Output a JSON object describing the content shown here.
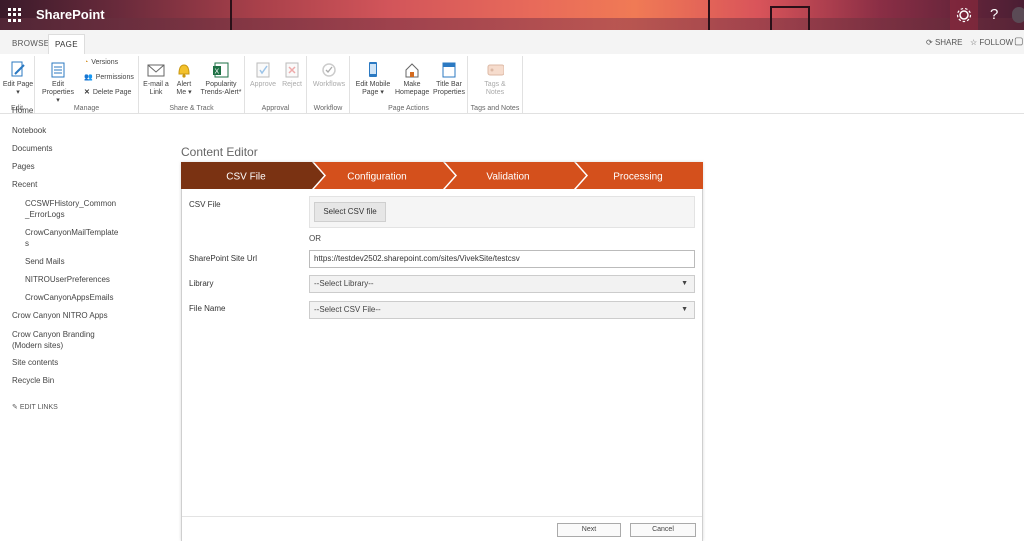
{
  "suite": {
    "brand": "SharePoint",
    "help_glyph": "?"
  },
  "ribbon_tabs": [
    "BROWSE",
    "PAGE"
  ],
  "actions": {
    "share": "SHARE",
    "follow": "FOLLOW"
  },
  "groups": {
    "edit": {
      "label": "Edit",
      "edit_page": "Edit Page"
    },
    "manage": {
      "label": "Manage",
      "edit_properties": "Edit Properties",
      "versions": "Versions",
      "permissions": "Permissions",
      "delete_page": "Delete Page"
    },
    "share_track": {
      "label": "Share & Track",
      "email_link": "E-mail a Link",
      "alert_me": "Alert Me",
      "popularity": "Popularity Trends-Alert*"
    },
    "approval": {
      "label": "Approval",
      "approve": "Approve",
      "reject": "Reject"
    },
    "workflow": {
      "label": "Workflow",
      "workflows": "Workflows"
    },
    "page_actions": {
      "label": "Page Actions",
      "edit_mobile": "Edit Mobile Page",
      "make_homepage": "Make Homepage",
      "title_bar": "Title Bar Properties"
    },
    "tags_notes": {
      "label": "Tags and Notes",
      "tags": "Tags & Notes"
    }
  },
  "left_nav": {
    "items": [
      "Home",
      "Notebook",
      "Documents",
      "Pages",
      "Recent",
      "CCSWFHistory_Common_ErrorLogs",
      "CrowCanyonMailTemplates",
      "Send Mails",
      "NITROUserPreferences",
      "CrowCanyonAppsEmails",
      "Crow Canyon NITRO Apps",
      "Crow Canyon Branding (Modern sites)",
      "Site contents",
      "Recycle Bin"
    ],
    "edit_links": "EDIT LINKS"
  },
  "content_editor": {
    "title": "Content Editor",
    "steps": [
      "CSV File",
      "Configuration",
      "Validation",
      "Processing"
    ],
    "csv_file_label": "CSV File",
    "select_csv_button": "Select CSV file",
    "or_text": "OR",
    "site_url_label": "SharePoint Site Url",
    "site_url_value": "https://testdev2502.sharepoint.com/sites/VivekSite/testcsv",
    "library_label": "Library",
    "library_value": "--Select Library--",
    "file_name_label": "File Name",
    "file_name_value": "--Select CSV File--",
    "next_button": "Next",
    "cancel_button": "Cancel"
  },
  "colors": {
    "step_active": "#7a3212",
    "step_inactive": "#d4501c"
  }
}
